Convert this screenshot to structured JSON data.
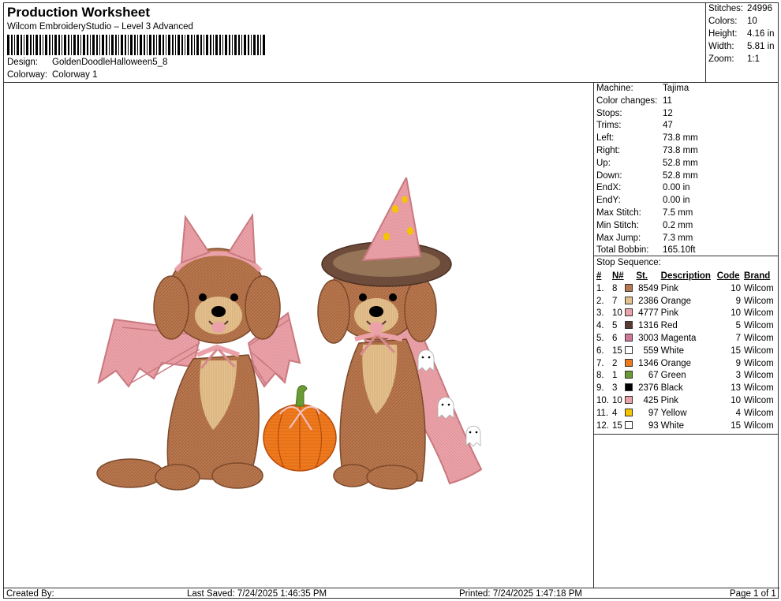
{
  "header": {
    "title": "Production Worksheet",
    "software": "Wilcom EmbroideryStudio – Level 3 Advanced",
    "design_label": "Design:",
    "design_value": "GoldenDoodleHalloween5_8",
    "colorway_label": "Colorway:",
    "colorway_value": "Colorway 1"
  },
  "top_stats": [
    {
      "label": "Stitches:",
      "value": "24996"
    },
    {
      "label": "Colors:",
      "value": "10"
    },
    {
      "label": "Height:",
      "value": "4.16 in"
    },
    {
      "label": "Width:",
      "value": "5.81 in"
    },
    {
      "label": "Zoom:",
      "value": "1:1"
    }
  ],
  "machine_info": [
    {
      "label": "Machine:",
      "value": "Tajima"
    },
    {
      "label": "Color changes:",
      "value": "11"
    },
    {
      "label": "Stops:",
      "value": "12"
    },
    {
      "label": "Trims:",
      "value": "47"
    },
    {
      "label": "Left:",
      "value": "73.8 mm"
    },
    {
      "label": "Right:",
      "value": "73.8 mm"
    },
    {
      "label": "Up:",
      "value": "52.8 mm"
    },
    {
      "label": "Down:",
      "value": "52.8 mm"
    },
    {
      "label": "EndX:",
      "value": "0.00 in"
    },
    {
      "label": "EndY:",
      "value": "0.00 in"
    },
    {
      "label": "Max Stitch:",
      "value": "7.5 mm"
    },
    {
      "label": "Min Stitch:",
      "value": "0.2 mm"
    },
    {
      "label": "Max Jump:",
      "value": "7.3 mm"
    },
    {
      "label": "Total Bobbin:",
      "value": "165.10ft"
    }
  ],
  "stop_sequence": {
    "title": "Stop Sequence:",
    "headers": {
      "num": "#",
      "n": "N#",
      "st": "St.",
      "desc": "Description",
      "code": "Code",
      "brand": "Brand"
    },
    "rows": [
      {
        "num": "1.",
        "n": "8",
        "color": "#b9774f",
        "st": "8549",
        "desc": "Pink",
        "code": "10",
        "brand": "Wilcom"
      },
      {
        "num": "2.",
        "n": "7",
        "color": "#e3c08c",
        "st": "2386",
        "desc": "Orange",
        "code": "9",
        "brand": "Wilcom"
      },
      {
        "num": "3.",
        "n": "10",
        "color": "#eaa2a8",
        "st": "4777",
        "desc": "Pink",
        "code": "10",
        "brand": "Wilcom"
      },
      {
        "num": "4.",
        "n": "5",
        "color": "#5a3a32",
        "st": "1316",
        "desc": "Red",
        "code": "5",
        "brand": "Wilcom"
      },
      {
        "num": "5.",
        "n": "6",
        "color": "#d1789a",
        "st": "3003",
        "desc": "Magenta",
        "code": "7",
        "brand": "Wilcom"
      },
      {
        "num": "6.",
        "n": "15",
        "color": "#ffffff",
        "st": "559",
        "desc": "White",
        "code": "15",
        "brand": "Wilcom"
      },
      {
        "num": "7.",
        "n": "2",
        "color": "#ef7a1e",
        "st": "1346",
        "desc": "Orange",
        "code": "9",
        "brand": "Wilcom"
      },
      {
        "num": "8.",
        "n": "1",
        "color": "#6b9a34",
        "st": "67",
        "desc": "Green",
        "code": "3",
        "brand": "Wilcom"
      },
      {
        "num": "9.",
        "n": "3",
        "color": "#000000",
        "st": "2376",
        "desc": "Black",
        "code": "13",
        "brand": "Wilcom"
      },
      {
        "num": "10.",
        "n": "10",
        "color": "#eaa2a8",
        "st": "425",
        "desc": "Pink",
        "code": "10",
        "brand": "Wilcom"
      },
      {
        "num": "11.",
        "n": "4",
        "color": "#f5c400",
        "st": "97",
        "desc": "Yellow",
        "code": "4",
        "brand": "Wilcom"
      },
      {
        "num": "12.",
        "n": "15",
        "color": "#ffffff",
        "st": "93",
        "desc": "White",
        "code": "15",
        "brand": "Wilcom"
      }
    ]
  },
  "footer": {
    "created": "Created By:",
    "saved": "Last Saved: 7/24/2025 1:46:35 PM",
    "printed": "Printed: 7/24/2025 1:47:18 PM",
    "page": "Page 1 of 1"
  },
  "colors": {
    "fur": "#b9774f",
    "fur_dark": "#7c4a2c",
    "chest": "#e3c08c",
    "pink": "#eaa2a8",
    "pink_dark": "#c9797f",
    "hat_brim": "#6e4c3c",
    "pumpkin": "#ef7a1e",
    "stem": "#6b9a34",
    "dots": "#f5c400"
  }
}
